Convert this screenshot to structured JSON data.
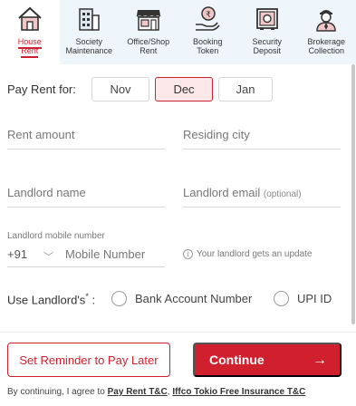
{
  "tabs": [
    {
      "line1": "House",
      "line2": "Rent",
      "icon": "house-icon",
      "active": true
    },
    {
      "line1": "Society",
      "line2": "Maintenance",
      "icon": "building-icon",
      "active": false
    },
    {
      "line1": "Office/Shop",
      "line2": "Rent",
      "icon": "shop-icon",
      "active": false
    },
    {
      "line1": "Booking",
      "line2": "Token",
      "icon": "hand-coin-icon",
      "active": false
    },
    {
      "line1": "Security",
      "line2": "Deposit",
      "icon": "safe-icon",
      "active": false
    },
    {
      "line1": "Brokerage",
      "line2": "Collection",
      "icon": "broker-icon",
      "active": false
    }
  ],
  "pay_for": {
    "label": "Pay Rent for:",
    "months": [
      "Nov",
      "Dec",
      "Jan"
    ],
    "selected": "Dec"
  },
  "fields": {
    "rent_amount": "Rent amount",
    "residing_city": "Residing city",
    "landlord_name": "Landlord name",
    "landlord_email": "Landlord email",
    "landlord_email_note": "(optional)",
    "mobile_caption": "Landlord mobile number",
    "country_code": "+91",
    "mobile_placeholder": "Mobile Number",
    "mobile_hint": "Your landlord gets an update"
  },
  "use_landlord": {
    "label": "Use Landlord's",
    "required_mark": "*",
    "colon": " :",
    "options": [
      "Bank Account Number",
      "UPI ID"
    ]
  },
  "actions": {
    "reminder": "Set Reminder to Pay Later",
    "continue": "Continue",
    "continue_arrow": "→"
  },
  "terms": {
    "prefix": "By continuing, I agree to ",
    "link1": "Pay Rent T&C",
    "sep": ", ",
    "link2": "Iffco Tokio Free Insurance T&C"
  },
  "colors": {
    "accent": "#d0202e",
    "tab_bar_bg": "#eef6fb",
    "selected_month_bg": "#fde8e9"
  }
}
